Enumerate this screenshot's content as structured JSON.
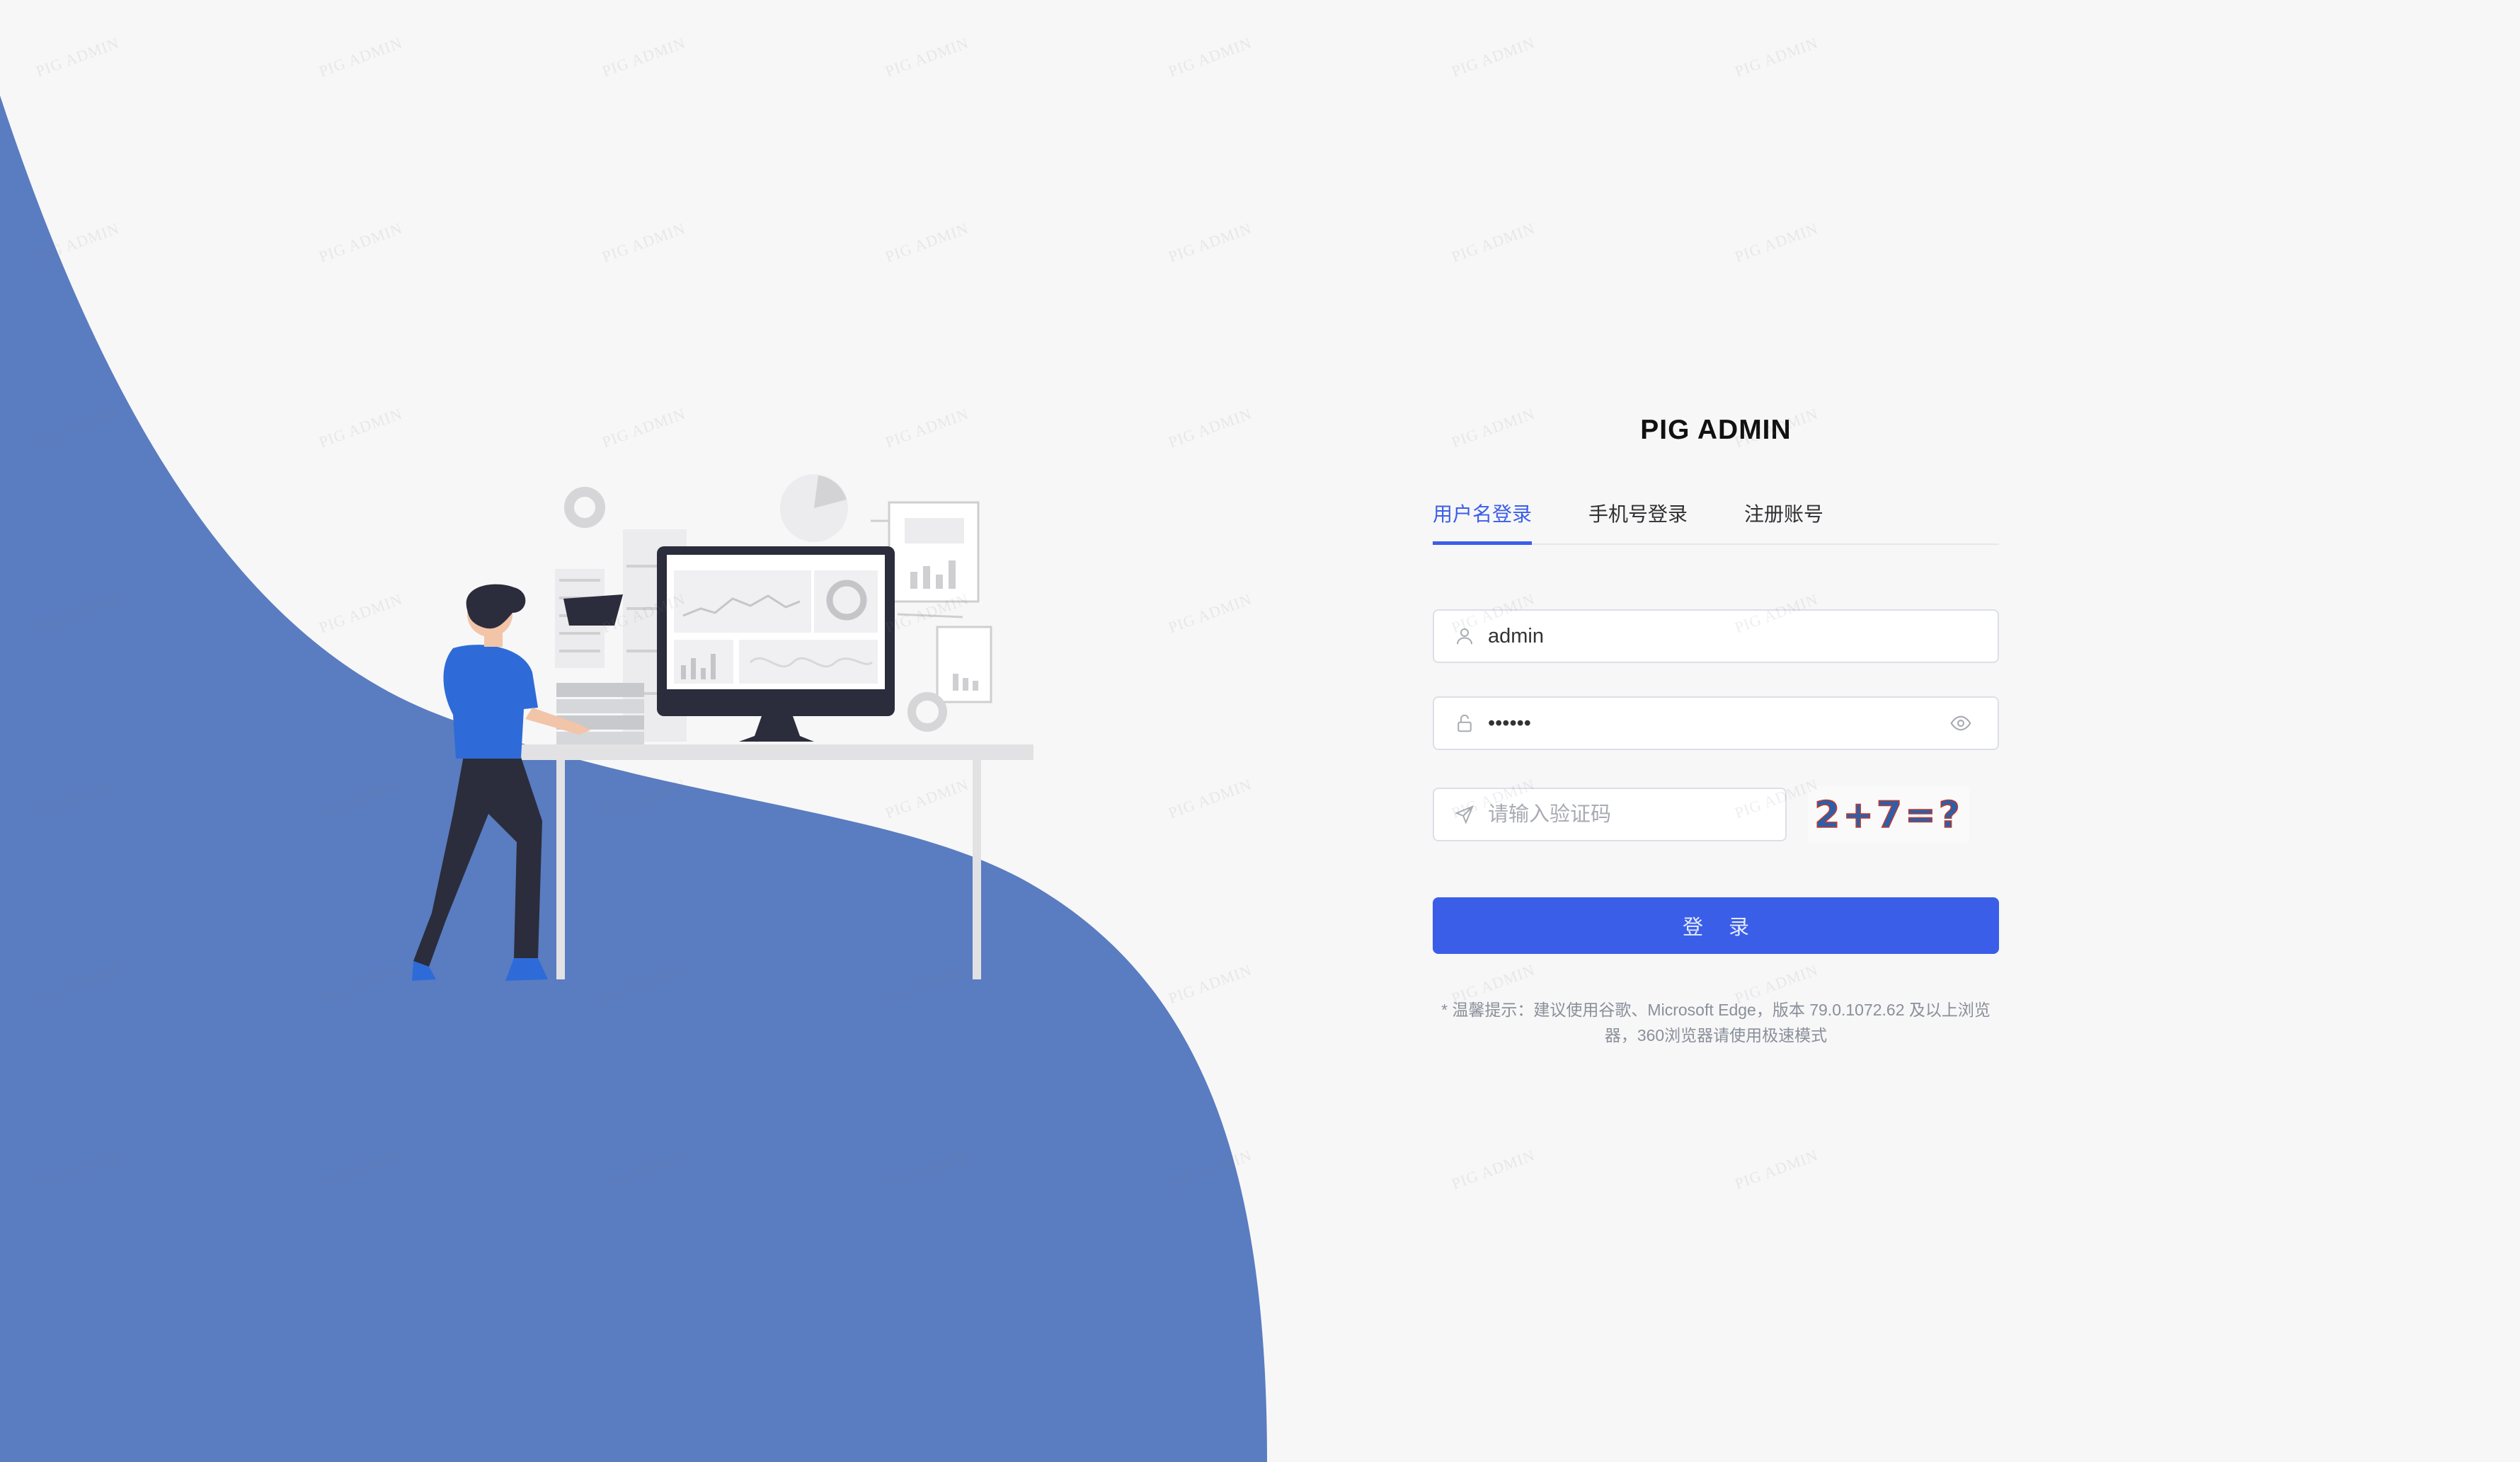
{
  "app": {
    "title": "PIG ADMIN"
  },
  "tabs": [
    {
      "label": "用户名登录",
      "active": true
    },
    {
      "label": "手机号登录",
      "active": false
    },
    {
      "label": "注册账号",
      "active": false
    }
  ],
  "form": {
    "username_value": "admin",
    "password_value": "••••••",
    "code_placeholder": "请输入验证码",
    "captcha_text": "2+7=?",
    "submit_label": "登 录"
  },
  "tip": "* 温馨提示：建议使用谷歌、Microsoft Edge，版本 79.0.1072.62 及以上浏览器，360浏览器请使用极速模式",
  "watermark": "PIG ADMIN",
  "colors": {
    "primary": "#3b5ee8",
    "wave": "#5a7cc0",
    "background": "#f7f7f8"
  }
}
